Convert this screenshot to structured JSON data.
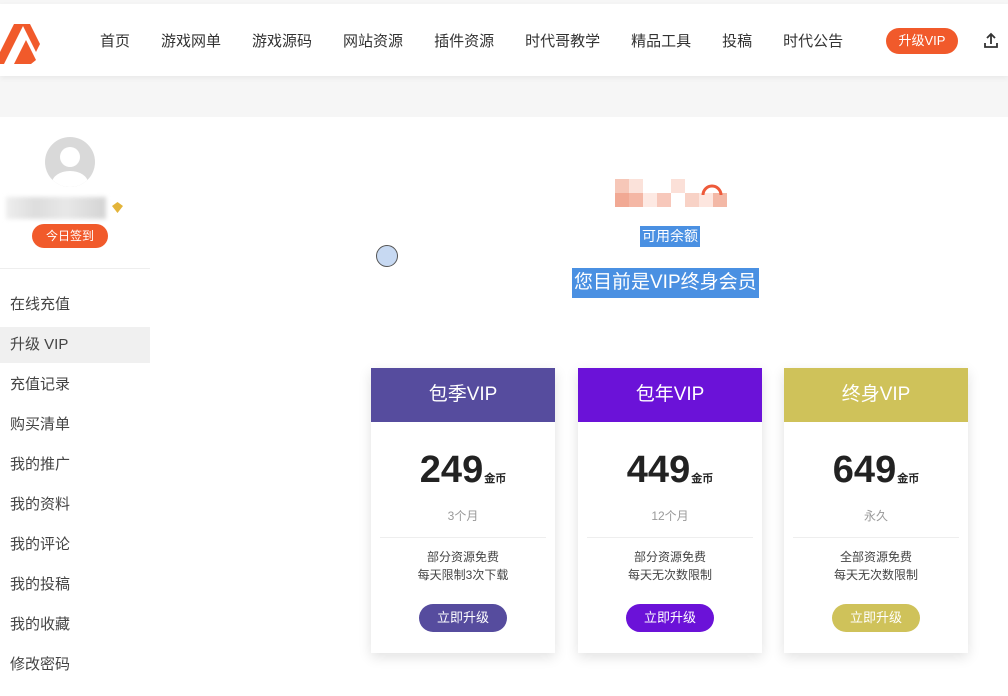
{
  "header": {
    "nav": [
      "首页",
      "游戏网单",
      "游戏源码",
      "网站资源",
      "插件资源",
      "时代哥教学",
      "精品工具",
      "投稿",
      "时代公告"
    ],
    "vip_button": "升级VIP",
    "upload_icon": "upload-icon"
  },
  "sidebar": {
    "checkin": "今日签到",
    "menu": [
      "在线充值",
      "升级 VIP",
      "充值记录",
      "购买清单",
      "我的推广",
      "我的资料",
      "我的评论",
      "我的投稿",
      "我的收藏",
      "修改密码"
    ],
    "active_index": 1
  },
  "main": {
    "available_label": "可用余额",
    "status": "您目前是VIP终身会员"
  },
  "plans": [
    {
      "name": "包季VIP",
      "price": "249",
      "unit": "金币",
      "period": "3个月",
      "desc1": "部分资源免费",
      "desc2": "每天限制3次下载",
      "button": "立即升级",
      "color": "#564c9e",
      "btn_color": "#564c9e"
    },
    {
      "name": "包年VIP",
      "price": "449",
      "unit": "金币",
      "period": "12个月",
      "desc1": "部分资源免费",
      "desc2": "每天无次数限制",
      "button": "立即升级",
      "color": "#6b12d8",
      "btn_color": "#6b12d8"
    },
    {
      "name": "终身VIP",
      "price": "649",
      "unit": "金币",
      "period": "永久",
      "desc1": "全部资源免费",
      "desc2": "每天无次数限制",
      "button": "立即升级",
      "color": "#cfc25a",
      "btn_color": "#cfc25a"
    }
  ]
}
